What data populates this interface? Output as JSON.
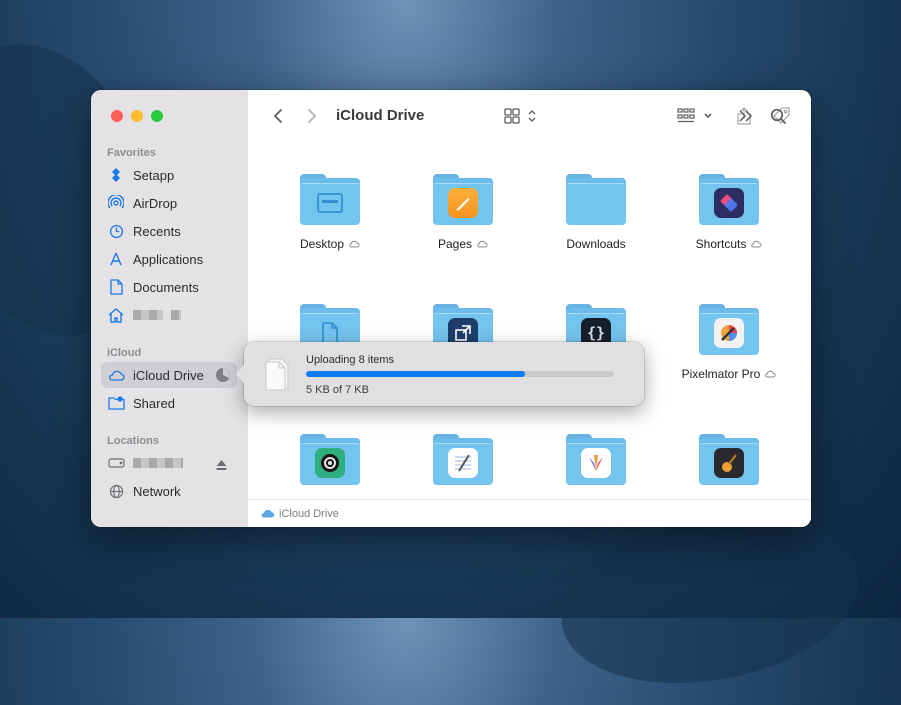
{
  "window": {
    "title": "iCloud Drive"
  },
  "sidebar": {
    "sections": [
      {
        "heading": "Favorites",
        "items": [
          {
            "label": "Setapp",
            "icon": "setapp-icon"
          },
          {
            "label": "AirDrop",
            "icon": "airdrop-icon"
          },
          {
            "label": "Recents",
            "icon": "clock-icon"
          },
          {
            "label": "Applications",
            "icon": "applications-icon"
          },
          {
            "label": "Documents",
            "icon": "document-icon"
          },
          {
            "label": "",
            "icon": "home-icon"
          }
        ]
      },
      {
        "heading": "iCloud",
        "items": [
          {
            "label": "iCloud Drive",
            "icon": "cloud-icon",
            "active": true
          },
          {
            "label": "Shared",
            "icon": "shared-folder-icon"
          }
        ]
      },
      {
        "heading": "Locations",
        "items": [
          {
            "label": "",
            "icon": "disk-icon"
          },
          {
            "label": "Network",
            "icon": "globe-icon"
          }
        ]
      }
    ]
  },
  "files": [
    {
      "name": "Desktop",
      "icon": "desktop-folder-icon",
      "cloud": true
    },
    {
      "name": "Pages",
      "icon": "pages-app-icon",
      "cloud": true
    },
    {
      "name": "Downloads",
      "icon": "folder-icon",
      "cloud": false
    },
    {
      "name": "Shortcuts",
      "icon": "shortcuts-app-icon",
      "cloud": true
    },
    {
      "name": "",
      "icon": "document-folder-icon"
    },
    {
      "name": "",
      "icon": "resize-app-icon"
    },
    {
      "name": "",
      "icon": "code-app-icon"
    },
    {
      "name": "Pixelmator Pro",
      "icon": "pixelmator-app-icon",
      "cloud": true
    },
    {
      "name": "",
      "icon": "camera-app-icon"
    },
    {
      "name": "",
      "icon": "notes-app-icon"
    },
    {
      "name": "",
      "icon": "affinity-app-icon"
    },
    {
      "name": "",
      "icon": "garageband-app-icon"
    }
  ],
  "status_bar": {
    "path": "iCloud Drive"
  },
  "upload": {
    "title": "Uploading 8 items",
    "detail": "5 KB of 7 KB",
    "progress": 0.71
  },
  "colors": {
    "accent": "#0a7cf5",
    "folder": "#74c4f0"
  }
}
